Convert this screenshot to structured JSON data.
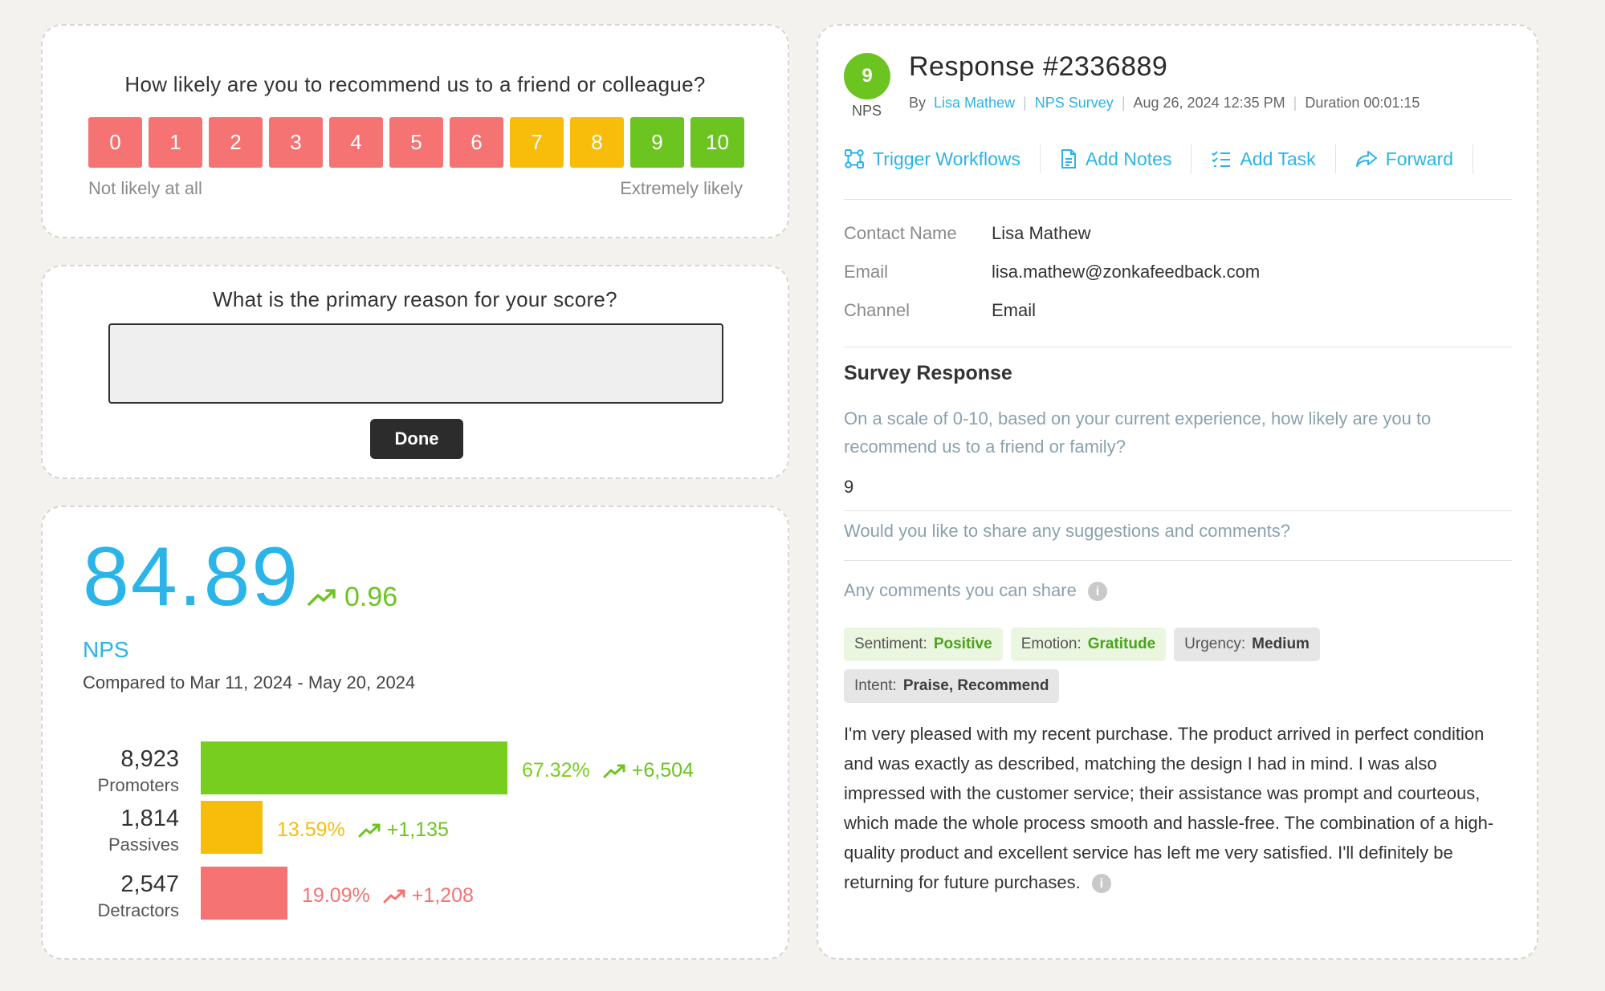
{
  "nps_question": {
    "title": "How likely are you to recommend us to a friend or colleague?",
    "scale": [
      {
        "label": "0",
        "color": "#f57372"
      },
      {
        "label": "1",
        "color": "#f57372"
      },
      {
        "label": "2",
        "color": "#f57372"
      },
      {
        "label": "3",
        "color": "#f57372"
      },
      {
        "label": "4",
        "color": "#f57372"
      },
      {
        "label": "5",
        "color": "#f57372"
      },
      {
        "label": "6",
        "color": "#f57372"
      },
      {
        "label": "7",
        "color": "#f7bd0a"
      },
      {
        "label": "8",
        "color": "#f7bd0a"
      },
      {
        "label": "9",
        "color": "#6cc420"
      },
      {
        "label": "10",
        "color": "#6cc420"
      }
    ],
    "low_label": "Not likely at all",
    "high_label": "Extremely likely"
  },
  "reason": {
    "title": "What is the primary reason for your score?",
    "input_value": "",
    "done_label": "Done"
  },
  "score": {
    "value": "84.89",
    "delta": "0.96",
    "label": "NPS",
    "compare": "Compared to Mar 11, 2024 - May 20, 2024",
    "rows": [
      {
        "count": "8,923",
        "category": "Promoters",
        "percent_label": "67.32%",
        "percent": 67.32,
        "delta": "+6,504",
        "color": "#78ce1f"
      },
      {
        "count": "1,814",
        "category": "Passives",
        "percent_label": "13.59%",
        "percent": 13.59,
        "delta": "+1,135",
        "color": "#f7bd0a"
      },
      {
        "count": "2,547",
        "category": "Detractors",
        "percent_label": "19.09%",
        "percent": 19.09,
        "delta": "+1,208",
        "color": "#f57372"
      }
    ]
  },
  "response": {
    "badge": "9",
    "badge_label": "NPS",
    "title": "Response #2336889",
    "by": "By",
    "author": "Lisa Mathew",
    "survey": "NPS Survey",
    "date": "Aug 26, 2024 12:35 PM",
    "duration": "Duration 00:01:15",
    "actions": {
      "trigger": "Trigger Workflows",
      "notes": "Add Notes",
      "task": "Add Task",
      "forward": "Forward"
    },
    "contact": {
      "name_key": "Contact Name",
      "name_val": "Lisa Mathew",
      "email_key": "Email",
      "email_val": "lisa.mathew@zonkafeedback.com",
      "channel_key": "Channel",
      "channel_val": "Email"
    },
    "section_title": "Survey Response",
    "q1": "On a scale of 0-10, based on your current experience, how likely are you to recommend us to a friend or family?",
    "a1": "9",
    "q2": "Would you like to share any suggestions and comments?",
    "q3": "Any comments you can share",
    "tags": {
      "sentiment_key": "Sentiment:",
      "sentiment_val": "Positive",
      "emotion_key": "Emotion:",
      "emotion_val": "Gratitude",
      "urgency_key": "Urgency:",
      "urgency_val": "Medium",
      "intent_key": "Intent:",
      "intent_val": "Praise, Recommend"
    },
    "comment": "I'm very pleased with my recent purchase. The product arrived in perfect condition and was exactly as described, matching the design I had in mind. I was also impressed with the customer service; their assistance was prompt and courteous, which made the whole process smooth and hassle-free. The combination of a high-quality product and excellent service has left me very satisfied. I'll definitely be returning for future purchases."
  }
}
